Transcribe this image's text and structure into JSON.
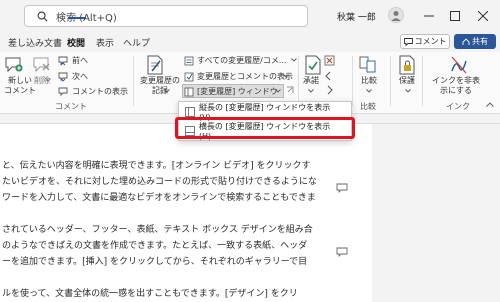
{
  "titlebar": {
    "search_placeholder": "検索 (Alt+Q)",
    "user_name": "秋葉 一郎"
  },
  "tabs": [
    {
      "label": "差し込み文書"
    },
    {
      "label": "校閲"
    },
    {
      "label": "表示"
    },
    {
      "label": "ヘルプ"
    }
  ],
  "actions": {
    "comment_label": "コメント",
    "share_label": "共有"
  },
  "ribbon": {
    "new_comment": "新しい\nコメント",
    "delete": "削除",
    "prev": "前へ",
    "next": "次へ",
    "show_comments": "コメントの表示",
    "comment_group": "コメント",
    "track_record": "変更履歴の\n記録",
    "markup_select": "すべての変更履歴/コメ...",
    "markup_show": "変更履歴とコメントの表示",
    "review_pane": "[変更履歴] ウィンドウ",
    "accept": "承諾",
    "compare": "比較",
    "compare_group": "比較",
    "protect": "保護",
    "ink_hide": "インクを非表\n示にする",
    "ink_group": "インク"
  },
  "dropdown": {
    "items": [
      {
        "label": "縦長の [変更履歴] ウィンドウを表示(V)..."
      },
      {
        "label": "横長の [変更履歴] ウィンドウを表示(H)..."
      }
    ]
  },
  "document": {
    "lines": [
      "と、伝えたい内容を明確に表現できます。[オンライン ビデオ] をクリックす",
      "たいビデオを、それに対した埋め込みコードの形式で貼り付けできるようにな",
      "ワードを入力して、文書に最適なビデオをオンラインで検索することもできま",
      "されているヘッダー、フッター、表紙、テキスト ボックス デザインを組み合",
      "のようなできばえの文書を作成できます。たとえば、一致する表紙、ヘッダ",
      "ーを追加できます。[挿入] をクリックしてから、それぞれのギャラリーで目",
      "ルを使って、文書全体の統一感を出すこともできます。[デザイン] をクリ"
    ]
  },
  "colors": {
    "accent": "#2b579a",
    "highlight": "#e0141e"
  }
}
